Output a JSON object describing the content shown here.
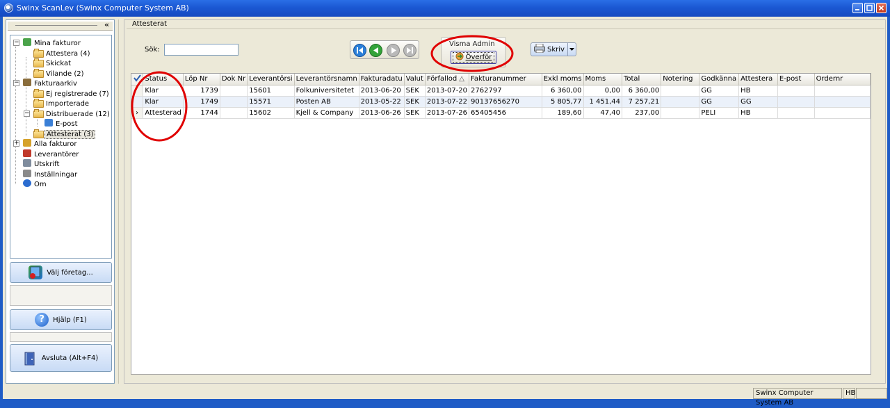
{
  "window": {
    "title": "Swinx ScanLev (Swinx Computer System AB)"
  },
  "sidebar": {
    "collapse_label": "«",
    "tree": [
      {
        "label": "Mina fakturor",
        "level": 0,
        "expander": "−",
        "icon": "invoice-check-icon"
      },
      {
        "label": "Attestera (4)",
        "level": 1,
        "icon": "folder-icon"
      },
      {
        "label": "Skickat",
        "level": 1,
        "icon": "folder-icon"
      },
      {
        "label": "Vilande (2)",
        "level": 1,
        "icon": "folder-icon"
      },
      {
        "label": "Fakturaarkiv",
        "level": 0,
        "expander": "−",
        "icon": "archive-icon"
      },
      {
        "label": "Ej registrerade (7)",
        "level": 1,
        "icon": "folder-icon"
      },
      {
        "label": "Importerade",
        "level": 1,
        "icon": "folder-icon"
      },
      {
        "label": "Distribuerade (12)",
        "level": 1,
        "expander": "−",
        "icon": "folder-icon"
      },
      {
        "label": "E-post",
        "level": 2,
        "icon": "email-icon"
      },
      {
        "label": "Attesterat (3)",
        "level": 1,
        "icon": "folder-open-icon",
        "selected": true
      },
      {
        "label": "Alla fakturor",
        "level": 0,
        "expander": "+",
        "icon": "all-invoices-icon"
      },
      {
        "label": "Leverantörer",
        "level": 0,
        "icon": "suppliers-icon"
      },
      {
        "label": "Utskrift",
        "level": 0,
        "icon": "printer-icon"
      },
      {
        "label": "Inställningar",
        "level": 0,
        "icon": "settings-icon"
      },
      {
        "label": "Om",
        "level": 0,
        "icon": "info-icon"
      }
    ],
    "choose_company_label": "Välj företag...",
    "help_label": "Hjälp (F1)",
    "exit_label": "Avsluta (Alt+F4)"
  },
  "main": {
    "header": "Attesterat",
    "search_label": "Sök:",
    "search_value": "",
    "visma_label": "Visma Admin",
    "transfer_label": "Överför",
    "print_label": "Skriv"
  },
  "grid": {
    "columns": [
      "Status",
      "Löp Nr",
      "Dok Nr",
      "Leverantörsi",
      "Leverantörsnamn",
      "Fakturadatu",
      "Valut",
      "Förfallod",
      "Fakturanummer",
      "Exkl moms",
      "Moms",
      "Total",
      "Notering",
      "Godkänna",
      "Attestera",
      "E-post",
      "Ordernr"
    ],
    "sort_indicator": "△",
    "rows": [
      {
        "indicator": "",
        "cells": [
          "Klar",
          "1739",
          "",
          "15601",
          "Folkuniversitetet",
          "2013-06-20",
          "SEK",
          "2013-07-20",
          "2762797",
          "6 360,00",
          "0,00",
          "6 360,00",
          "",
          "GG",
          "HB",
          "",
          ""
        ]
      },
      {
        "indicator": "",
        "cells": [
          "Klar",
          "1749",
          "",
          "15571",
          "Posten AB",
          "2013-05-22",
          "SEK",
          "2013-07-22",
          "90137656270",
          "5 805,77",
          "1 451,44",
          "7 257,21",
          "",
          "GG",
          "GG",
          "",
          ""
        ]
      },
      {
        "indicator": "›",
        "cells": [
          "Attesterad",
          "1744",
          "",
          "15602",
          "Kjell & Company",
          "2013-06-26",
          "SEK",
          "2013-07-26",
          "65405456",
          "189,60",
          "47,40",
          "237,00",
          "",
          "PELI",
          "HB",
          "",
          ""
        ]
      }
    ]
  },
  "statusbar": {
    "company": "Swinx Computer System AB",
    "user": "HB"
  },
  "colors": {
    "titlebar": "#1b58d3",
    "annotation": "#e00000",
    "alt_row": "#ebf1fa"
  }
}
